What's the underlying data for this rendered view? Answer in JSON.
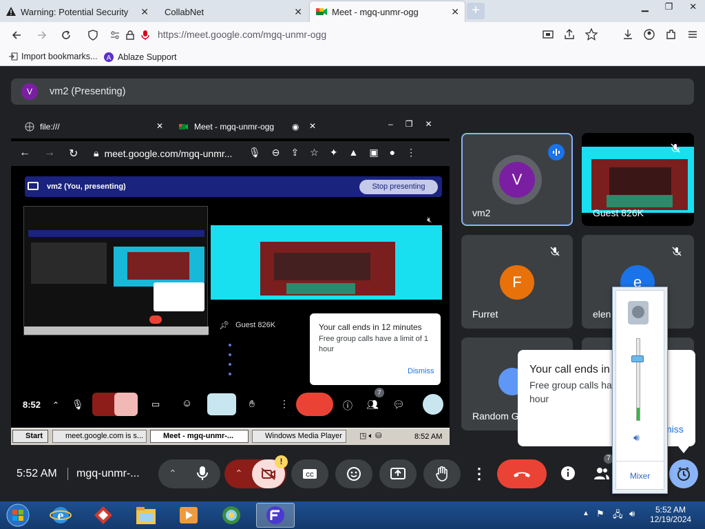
{
  "browser": {
    "tabs": [
      {
        "label": "Warning: Potential Security Risk"
      },
      {
        "label": "CollabNet"
      },
      {
        "label": "Meet - mgq-unmr-ogg"
      }
    ],
    "url": "https://meet.google.com/mgq-unmr-ogg",
    "bookmarks": [
      "Import bookmarks...",
      "Ablaze Support"
    ]
  },
  "meet": {
    "presenter_initial": "V",
    "presenter_label": "vm2 (Presenting)",
    "tiles": [
      {
        "name": "vm2",
        "initial": "V",
        "color": "#7b1fa2"
      },
      {
        "name": "Guest 826K"
      },
      {
        "name": "Furret",
        "initial": "F",
        "color": "#e8710a"
      },
      {
        "name": "elen",
        "initial": "e",
        "color": "#1a73e8"
      },
      {
        "name": "Random G"
      }
    ],
    "call_popup": {
      "title": "Your call ends in",
      "body": "Free group calls ha",
      "body2": "hour",
      "dismiss": "miss"
    },
    "bottom": {
      "time": "5:52 AM",
      "meeting_code": "mgq-unmr-...",
      "participants_badge": "7",
      "warning_badge": "!"
    }
  },
  "shared_screen": {
    "tabs": [
      {
        "label": "file:///"
      },
      {
        "label": "Meet - mgq-unmr-ogg"
      }
    ],
    "url": "meet.google.com/mgq-unmr...",
    "presenting_label": "vm2 (You, presenting)",
    "stop_button": "Stop presenting",
    "guest_label": "Guest 826K",
    "popup": {
      "title": "Your call ends in 12 minutes",
      "body": "Free group calls have a limit of 1 hour",
      "dismiss": "Dismiss"
    },
    "time": "8:52",
    "badge": "7",
    "taskbar": {
      "start": "Start",
      "items": [
        "meet.google.com is s...",
        "Meet - mgq-unmr-...",
        "Windows Media Player"
      ],
      "clock": "8:52 AM"
    }
  },
  "volume_mixer": {
    "label": "Mixer",
    "level": 0.75
  },
  "taskbar": {
    "time": "5:52 AM",
    "date": "12/19/2024"
  },
  "colors": {
    "meet_bg": "#202124",
    "tile_bg": "#3c4043",
    "end_call": "#ea4335",
    "accent_blue": "#8ab4f8"
  }
}
